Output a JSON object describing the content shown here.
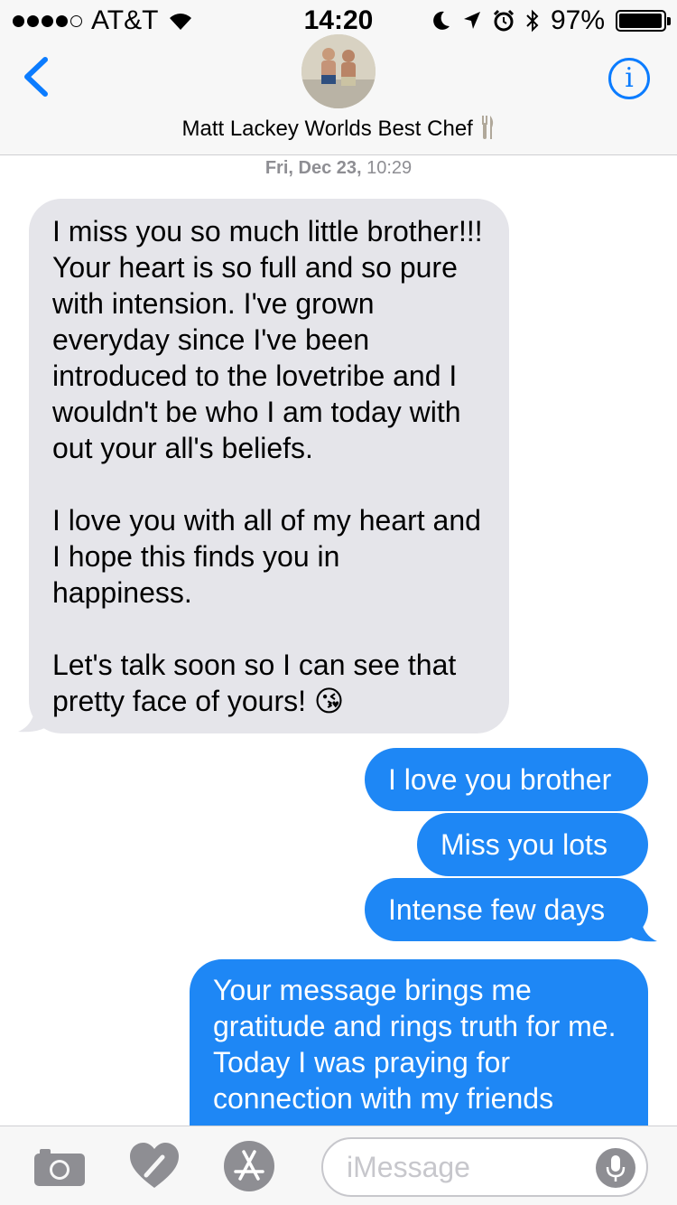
{
  "status_bar": {
    "carrier": "AT&T",
    "time": "14:20",
    "battery": "97%",
    "battery_level": 0.97
  },
  "header": {
    "contact_name": "Matt Lackey Worlds Best Chef"
  },
  "conversation": {
    "timestamp_day": "Fri, Dec 23,",
    "timestamp_time": "10:29",
    "messages": [
      {
        "direction": "incoming",
        "text": "I miss you so much little brother!!! Your heart is so full and so pure with intension. I've grown everyday since I've been introduced to the lovetribe and I wouldn't be who I am today with out your all's beliefs.\n\nI love you with all of my heart and I hope this finds you in happiness.\n\nLet's talk soon so I can see that pretty face of yours! 😘"
      },
      {
        "direction": "outgoing",
        "text": "I love you brother"
      },
      {
        "direction": "outgoing",
        "text": "Miss you lots"
      },
      {
        "direction": "outgoing",
        "text": "Intense few days"
      },
      {
        "direction": "outgoing",
        "text": "Your message brings me gratitude and rings truth for me. Today I was praying for connection with my friends"
      }
    ]
  },
  "input_bar": {
    "placeholder": "iMessage"
  },
  "icons": {
    "back": "chevron-left-icon",
    "info": "info-icon",
    "camera": "camera-icon",
    "digital_touch": "heart-icon",
    "app_store": "app-store-icon",
    "mic": "microphone-icon"
  },
  "colors": {
    "accent": "#0b7cff",
    "incoming_bubble": "#e5e5ea",
    "outgoing_bubble": "#1e87f5"
  }
}
